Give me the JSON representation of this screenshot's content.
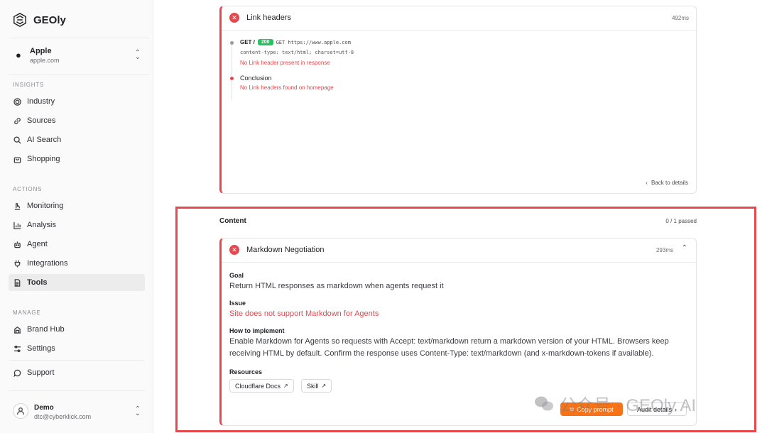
{
  "app": {
    "name": "GEOly"
  },
  "org": {
    "name": "Apple",
    "domain": "apple.com"
  },
  "sidebar": {
    "insights_label": "INSIGHTS",
    "insights": [
      {
        "label": "Industry",
        "icon": "target-icon"
      },
      {
        "label": "Sources",
        "icon": "link-icon"
      },
      {
        "label": "AI Search",
        "icon": "search-icon"
      },
      {
        "label": "Shopping",
        "icon": "shopping-bag-icon"
      }
    ],
    "actions_label": "ACTIONS",
    "actions": [
      {
        "label": "Monitoring",
        "icon": "microscope-icon"
      },
      {
        "label": "Analysis",
        "icon": "bar-chart-icon"
      },
      {
        "label": "Agent",
        "icon": "robot-icon"
      },
      {
        "label": "Integrations",
        "icon": "plug-icon"
      },
      {
        "label": "Tools",
        "icon": "document-icon"
      }
    ],
    "manage_label": "MANAGE",
    "manage": [
      {
        "label": "Brand Hub",
        "icon": "building-icon"
      },
      {
        "label": "Settings",
        "icon": "sliders-icon"
      }
    ],
    "support": {
      "label": "Support",
      "icon": "chat-icon"
    }
  },
  "user": {
    "name": "Demo",
    "email": "dtc@cyberklick.com"
  },
  "link_headers_card": {
    "title": "Link headers",
    "duration": "492ms",
    "step1": {
      "method": "GET /",
      "status": "200",
      "request": "GET https://www.apple.com",
      "header_line": "content-type: text/html; charset=utf-8",
      "result": "No Link header present in response"
    },
    "conclusion": {
      "title": "Conclusion",
      "text": "No Link headers found on homepage"
    },
    "back_label": "Back to details"
  },
  "content_section": {
    "title": "Content",
    "passed": "0 / 1 passed",
    "card": {
      "title": "Markdown Negotiation",
      "duration": "293ms",
      "goal_label": "Goal",
      "goal": "Return HTML responses as markdown when agents request it",
      "issue_label": "Issue",
      "issue": "Site does not support Markdown for Agents",
      "how_label": "How to implement",
      "how_line1": "Enable Markdown for Agents so requests with Accept: text/markdown return a markdown version of your HTML. Browsers keep",
      "how_line2": "receiving HTML by default. Confirm the response uses Content-Type: text/markdown (and x-markdown-tokens if available).",
      "resources_label": "Resources",
      "resources": [
        "Cloudflare Docs",
        "Skill"
      ],
      "copy_label": "Copy prompt",
      "audit_label": "Audit details"
    }
  },
  "watermark": "公众号 · GEOly AI",
  "colors": {
    "error": "#e5484d",
    "accent": "#f97316",
    "success": "#22c55e"
  }
}
